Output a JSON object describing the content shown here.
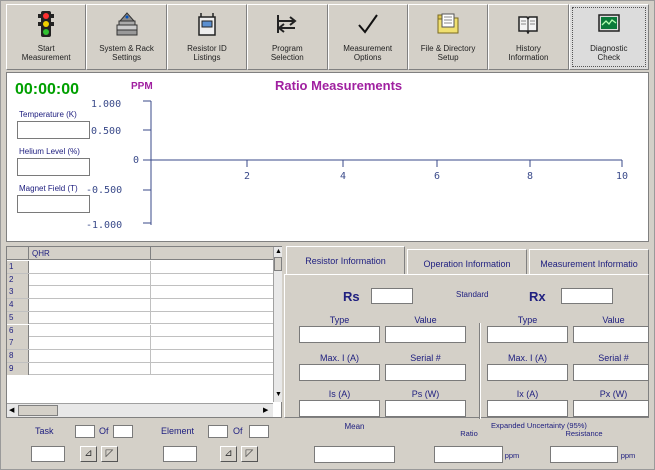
{
  "toolbar": {
    "buttons": [
      {
        "label": "Start\nMeasurement",
        "icon": "traffic-light-icon"
      },
      {
        "label": "System & Rack\nSettings",
        "icon": "rack-icon"
      },
      {
        "label": "Resistor ID\nListings",
        "icon": "resistor-icon"
      },
      {
        "label": "Program\nSelection",
        "icon": "arrows-icon"
      },
      {
        "label": "Measurement\nOptions",
        "icon": "checkmark-icon"
      },
      {
        "label": "File & Directory\nSetup",
        "icon": "folder-icon"
      },
      {
        "label": "History\nInformation",
        "icon": "book-icon"
      },
      {
        "label": "Diagnostic\nCheck",
        "icon": "monitor-icon"
      }
    ]
  },
  "graph": {
    "timer": "00:00:00",
    "unit": "PPM",
    "title": "Ratio Measurements",
    "fields": {
      "temperature_label": "Temperature (K)",
      "helium_label": "Helium Level (%)",
      "magnet_label": "Magnet Field (T)"
    },
    "y_ticks": [
      "1.000",
      "0.500",
      "0",
      "-0.500",
      "-1.000"
    ],
    "x_ticks": [
      "2",
      "4",
      "6",
      "8",
      "10"
    ]
  },
  "table": {
    "header": "QHR",
    "rows": [
      "1",
      "2",
      "3",
      "4",
      "5",
      "6",
      "7",
      "8",
      "9"
    ]
  },
  "task": {
    "task_label": "Task",
    "of_label": "Of",
    "element_label": "Element",
    "of_label2": "Of"
  },
  "tabs": [
    "Resistor Information",
    "Operation Information",
    "Measurement Informatio"
  ],
  "resistor": {
    "rs": "Rs",
    "rx": "Rx",
    "standard": "Standard",
    "left": {
      "type": "Type",
      "value": "Value",
      "maxi": "Max. I  (A)",
      "serial": "Serial #",
      "i": "Is (A)",
      "p": "Ps (W)"
    },
    "right": {
      "type": "Type",
      "value": "Value",
      "maxi": "Max. I  (A)",
      "serial": "Serial #",
      "i": "Ix   (A)",
      "p": "Px  (W)"
    }
  },
  "uncertainty": {
    "mean": "Mean",
    "expanded": "Expanded Uncertainty (95%)",
    "ratio": "Ratio",
    "resistance": "Resistance",
    "ppm1": "ppm",
    "ppm2": "ppm"
  }
}
